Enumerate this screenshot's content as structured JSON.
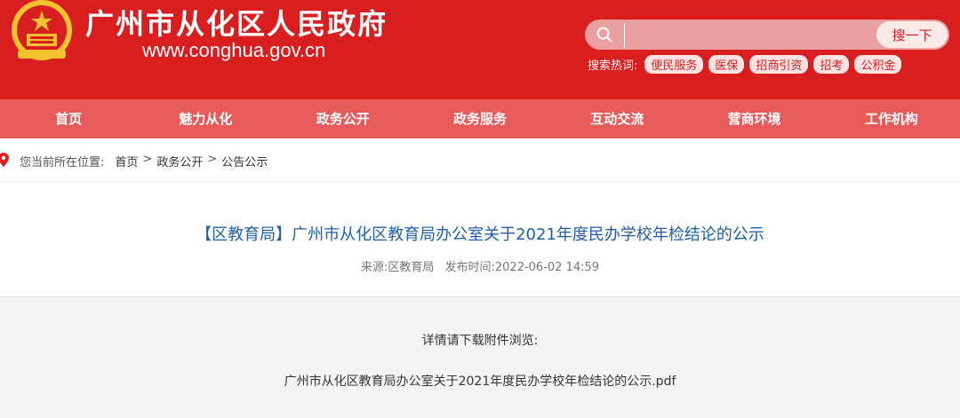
{
  "header": {
    "title": "广州市从化区人民政府",
    "url": "www.conghua.gov.cn",
    "emblem_icon": "national-emblem-icon"
  },
  "search": {
    "placeholder": "",
    "button_label": "搜一下",
    "hot_label": "搜索热词:",
    "hot_words": [
      "便民服务",
      "医保",
      "招商引资",
      "招考",
      "公积金"
    ]
  },
  "nav": {
    "items": [
      "首页",
      "魅力从化",
      "政务公开",
      "政务服务",
      "互动交流",
      "营商环境",
      "工作机构"
    ]
  },
  "breadcrumb": {
    "label": "您当前所在位置:",
    "items": [
      "首页",
      "政务公开",
      "公告公示"
    ],
    "separator": ">"
  },
  "article": {
    "title": "【区教育局】广州市从化区教育局办公室关于2021年度民办学校年检结论的公示",
    "source": "来源:区教育局",
    "publish_time": "发布时间:2022-06-02 14:59",
    "detail_text": "详情请下载附件浏览:",
    "attachment_name": "广州市从化区教育局办公室关于2021年度民办学校年检结论的公示.pdf"
  },
  "colors": {
    "header_red": "#d81e1e",
    "nav_red": "#e75b5b",
    "title_blue": "#1f5fa9"
  }
}
